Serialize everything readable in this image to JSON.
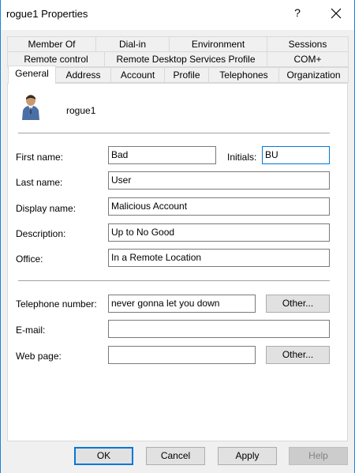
{
  "window": {
    "title": "rogue1 Properties",
    "help_glyph": "?",
    "close_icon": "close-icon"
  },
  "tabs": {
    "row1": [
      "Member Of",
      "Dial-in",
      "Environment",
      "Sessions"
    ],
    "row2": [
      "Remote control",
      "Remote Desktop Services Profile",
      "COM+"
    ],
    "row3": [
      "General",
      "Address",
      "Account",
      "Profile",
      "Telephones",
      "Organization"
    ],
    "active": "General"
  },
  "general": {
    "user_icon": "user-icon",
    "username": "rogue1",
    "first_name": {
      "label": "First name:",
      "value": "Bad"
    },
    "initials": {
      "label": "Initials:",
      "value": "BU"
    },
    "last_name": {
      "label": "Last name:",
      "value": "User"
    },
    "display_name": {
      "label": "Display name:",
      "value": "Malicious Account"
    },
    "description": {
      "label": "Description:",
      "value": "Up to No Good"
    },
    "office": {
      "label": "Office:",
      "value": "In a Remote Location"
    },
    "telephone": {
      "label": "Telephone number:",
      "value": "never gonna let you down",
      "other_label": "Other..."
    },
    "email": {
      "label": "E-mail:",
      "value": ""
    },
    "web_page": {
      "label": "Web page:",
      "value": "",
      "other_label": "Other..."
    }
  },
  "buttons": {
    "ok": "OK",
    "cancel": "Cancel",
    "apply": "Apply",
    "help": "Help"
  },
  "colors": {
    "accent": "#0078d7",
    "window_border": "#1883d7",
    "dialog_bg": "#f0f0f0"
  }
}
